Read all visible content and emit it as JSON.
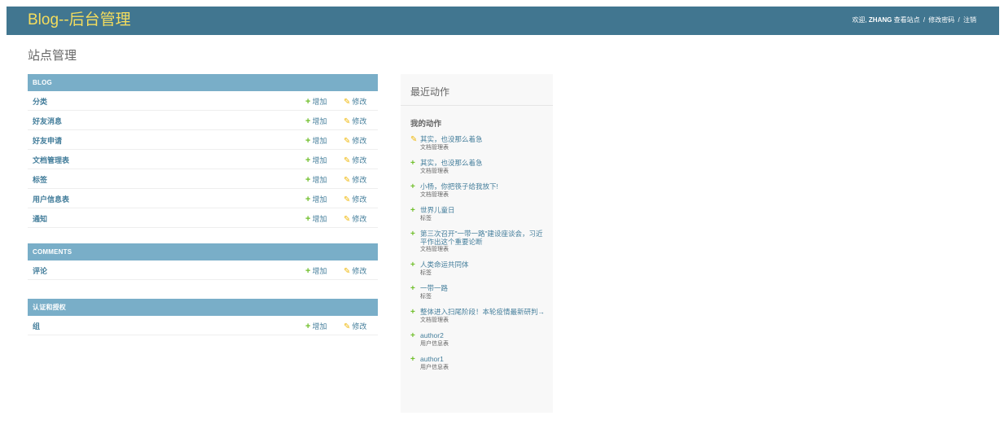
{
  "header": {
    "branding": "Blog--后台管理",
    "welcome": "欢迎,",
    "username": "ZHANG",
    "view_site": "查看站点",
    "change_password": "修改密码",
    "logout": "注销",
    "separator": "/"
  },
  "page_title": "站点管理",
  "labels": {
    "add": "增加",
    "change": "修改"
  },
  "modules": [
    {
      "caption": "BLOG",
      "models": [
        "分类",
        "好友消息",
        "好友申请",
        "文档管理表",
        "标签",
        "用户信息表",
        "通知"
      ]
    },
    {
      "caption": "COMMENTS",
      "models": [
        "评论"
      ]
    },
    {
      "caption": "认证和授权",
      "models": [
        "组"
      ]
    }
  ],
  "recent": {
    "title": "最近动作",
    "subtitle": "我的动作",
    "actions": [
      {
        "kind": "edit",
        "text": "其实，也没那么着急",
        "type": "文档管理表"
      },
      {
        "kind": "add",
        "text": "其实，也没那么着急",
        "type": "文档管理表"
      },
      {
        "kind": "add",
        "text": "小杨，你把筷子给我放下!",
        "type": "文档管理表"
      },
      {
        "kind": "add",
        "text": "世界儿童日",
        "type": "标签"
      },
      {
        "kind": "add",
        "text": "第三次召开\"一带一路\"建设座谈会，习近平作出这个重要论断",
        "type": "文档管理表"
      },
      {
        "kind": "add",
        "text": "人类命运共同体",
        "type": "标签"
      },
      {
        "kind": "add",
        "text": "一带一路",
        "type": "标签"
      },
      {
        "kind": "add",
        "text": "整体进入扫尾阶段！本轮疫情最新研判→",
        "type": "文档管理表"
      },
      {
        "kind": "add",
        "text": "author2",
        "type": "用户信息表"
      },
      {
        "kind": "add",
        "text": "author1",
        "type": "用户信息表"
      }
    ]
  }
}
